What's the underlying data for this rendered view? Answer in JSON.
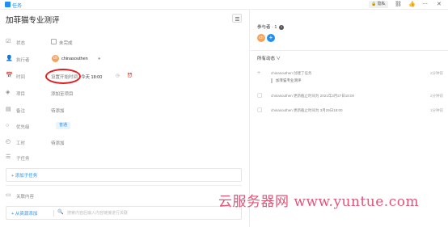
{
  "topbar": {
    "app_title": "任务",
    "private_label": "隐私",
    "icons": [
      "lock-icon",
      "link-icon",
      "thumbs-up-icon",
      "more-icon",
      "close-icon"
    ]
  },
  "task": {
    "title": "加菲猫专业测评"
  },
  "fields": {
    "status": {
      "label": "状态",
      "value": "未完成"
    },
    "assignee": {
      "label": "执行者",
      "value": "chinasouthen",
      "avatar": "ch"
    },
    "time": {
      "label": "时间",
      "start_placeholder": "设置开始时间",
      "dash": "-",
      "due": "今天 18:00"
    },
    "project": {
      "label": "项目",
      "value": "添加至项目"
    },
    "note": {
      "label": "备注",
      "value": "待添加"
    },
    "priority": {
      "label": "优先级",
      "value": "普通"
    },
    "hours": {
      "label": "工时",
      "value": "待添加"
    },
    "subtask": {
      "label": "子任务"
    }
  },
  "subtask_box": {
    "add_label": "+ 添加子任务"
  },
  "related": {
    "label": "关联内容"
  },
  "bottom_bar": {
    "add_label": "+ 从资源添加",
    "placeholder": "搜索内容后输入内容链接进行关联"
  },
  "right": {
    "participants_label": "参与者 · 1",
    "help": "?",
    "avatar": "ch",
    "add": "+",
    "dynamics_label": "所有动态 ∨",
    "activities": [
      {
        "icon": "plus-icon",
        "text": "chinasouthen 创建了任务",
        "time": "2分钟前",
        "quote": "加菲猫专业测评"
      },
      {
        "icon": "calendar-icon",
        "text": "chinasouthen 更新截止时间为 2021年3月27日18:00",
        "time": "2分钟前"
      },
      {
        "icon": "calendar-icon",
        "text": "chinasouthen 更新截止时间为 3月29日18:00",
        "time": "1分钟前"
      }
    ]
  },
  "watermark": "云服务器网 www.yuntue.com",
  "colors": {
    "accent": "#1f8ff0",
    "highlight_circle": "#e02020",
    "watermark": "#e0557a"
  }
}
